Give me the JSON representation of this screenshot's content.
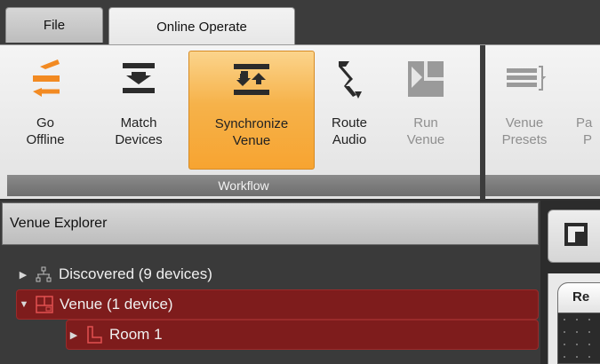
{
  "tabs": [
    {
      "label": "File"
    },
    {
      "label": "Online Operate"
    }
  ],
  "ribbon": {
    "buttons": [
      {
        "label_line1": "Go",
        "label_line2": "Offline",
        "icon": "go-offline-icon",
        "state": "normal"
      },
      {
        "label_line1": "Match",
        "label_line2": "Devices",
        "icon": "match-devices-icon",
        "state": "normal"
      },
      {
        "label_line1": "Synchronize",
        "label_line2": "Venue",
        "icon": "synchronize-venue-icon",
        "state": "active"
      },
      {
        "label_line1": "Route",
        "label_line2": "Audio",
        "icon": "route-audio-icon",
        "state": "normal"
      },
      {
        "label_line1": "Run",
        "label_line2": "Venue",
        "icon": "run-venue-icon",
        "state": "disabled"
      },
      {
        "label_line1": "Venue",
        "label_line2": "Presets",
        "icon": "venue-presets-icon",
        "state": "disabled"
      },
      {
        "label_line1": "Pa",
        "label_line2": "P",
        "icon": "partial-icon",
        "state": "disabled"
      }
    ],
    "groups": [
      {
        "label": "Workflow"
      }
    ]
  },
  "explorer": {
    "title": "Venue Explorer",
    "tree": [
      {
        "label": "Discovered (9 devices)",
        "expanded": false,
        "selected": false,
        "icon": "network-icon"
      },
      {
        "label": "Venue (1 device)",
        "expanded": true,
        "selected": true,
        "icon": "venue-icon"
      },
      {
        "label": "Room 1",
        "expanded": false,
        "selected": true,
        "icon": "room-icon"
      }
    ]
  },
  "right_panel": {
    "subtab_label": "Re"
  },
  "colors": {
    "accent_orange": "#f29a2e",
    "selection_red": "#7e1c1c",
    "dark_chrome": "#3c3c3c"
  }
}
